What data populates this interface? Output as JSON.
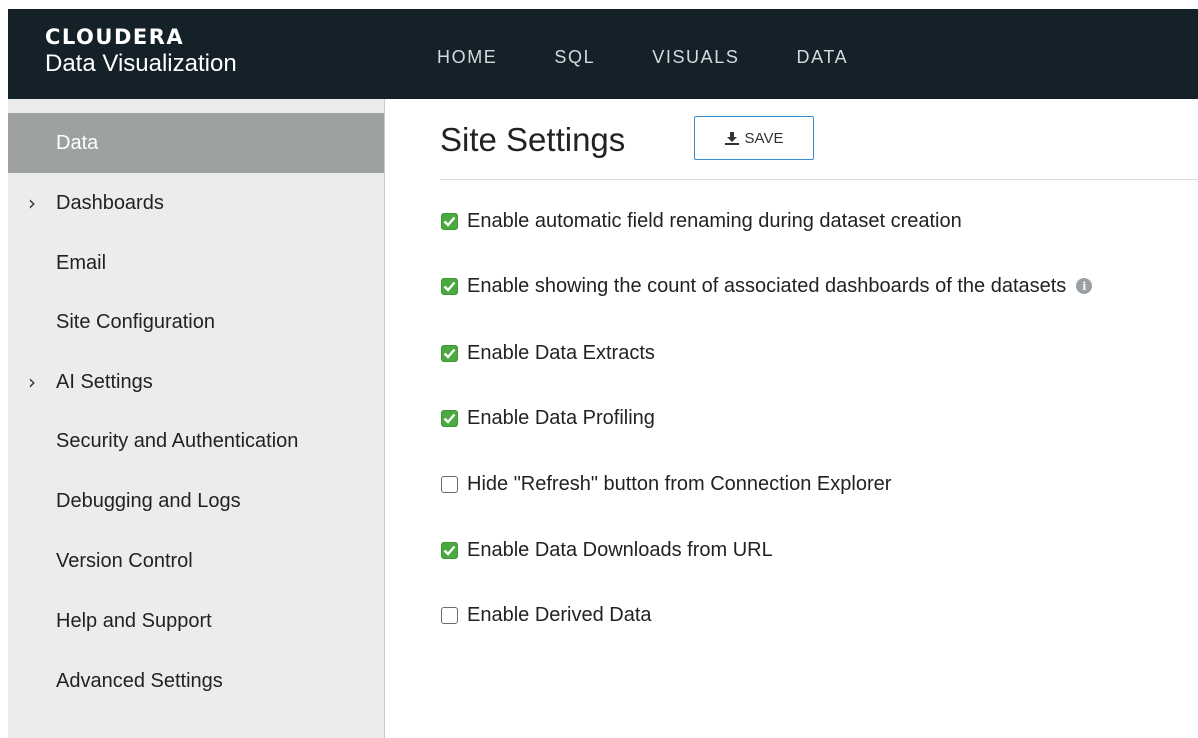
{
  "brand": {
    "name": "CLOUDERA",
    "product": "Data Visualization"
  },
  "nav": [
    "HOME",
    "SQL",
    "VISUALS",
    "DATA"
  ],
  "sidebar": {
    "items": [
      {
        "label": "Data",
        "active": true,
        "expandable": false
      },
      {
        "label": "Dashboards",
        "active": false,
        "expandable": true
      },
      {
        "label": "Email",
        "active": false,
        "expandable": false
      },
      {
        "label": "Site Configuration",
        "active": false,
        "expandable": false
      },
      {
        "label": "AI Settings",
        "active": false,
        "expandable": true
      },
      {
        "label": "Security and Authentication",
        "active": false,
        "expandable": false
      },
      {
        "label": "Debugging and Logs",
        "active": false,
        "expandable": false
      },
      {
        "label": "Version Control",
        "active": false,
        "expandable": false
      },
      {
        "label": "Help and Support",
        "active": false,
        "expandable": false
      },
      {
        "label": "Advanced Settings",
        "active": false,
        "expandable": false
      }
    ]
  },
  "main": {
    "title": "Site Settings",
    "save_label": "SAVE",
    "options": [
      {
        "label": "Enable automatic field renaming during dataset creation",
        "checked": true
      },
      {
        "label": "Enable showing the count of associated dashboards of the datasets",
        "checked": true,
        "info": true
      },
      {
        "label": "Enable Data Extracts",
        "checked": true
      },
      {
        "label": "Enable Data Profiling",
        "checked": true
      },
      {
        "label": "Hide \"Refresh\" button from Connection Explorer",
        "checked": false
      },
      {
        "label": "Enable Data Downloads from URL",
        "checked": true
      },
      {
        "label": "Enable Derived Data",
        "checked": false
      }
    ]
  },
  "colors": {
    "topbar": "#142129",
    "active_sidebar": "#9ea1a2",
    "checkbox_checked": "#4aa93f",
    "save_border": "#3a8ad0"
  },
  "icons": {
    "chevron": "chevron-right-icon",
    "save": "download-icon",
    "check": "checkmark-icon",
    "info": "info-icon"
  }
}
